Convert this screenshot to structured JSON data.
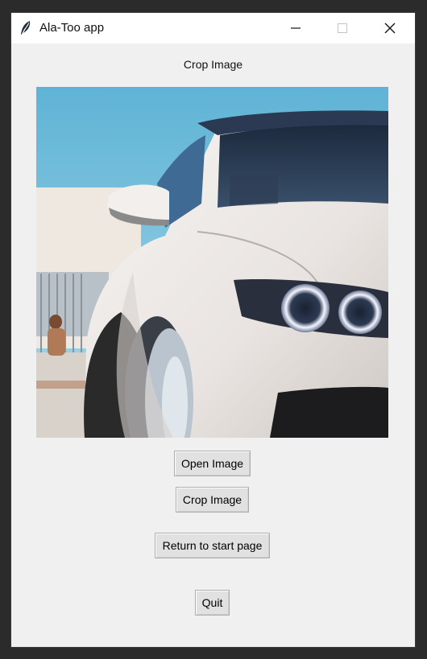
{
  "window": {
    "title": "Ala-Too app",
    "controls": {
      "minimize_icon": "minimize-icon",
      "maximize_icon": "maximize-icon",
      "close_icon": "close-icon"
    }
  },
  "page": {
    "heading": "Crop Image"
  },
  "image": {
    "description_icon": "car-photo"
  },
  "buttons": {
    "open": "Open Image",
    "crop": "Crop Image",
    "return": "Return to start page",
    "quit": "Quit"
  },
  "colors": {
    "window_bg": "#f0f0f0",
    "titlebar_bg": "#ffffff",
    "button_bg": "#e1e1e1",
    "button_border": "#adadad"
  }
}
